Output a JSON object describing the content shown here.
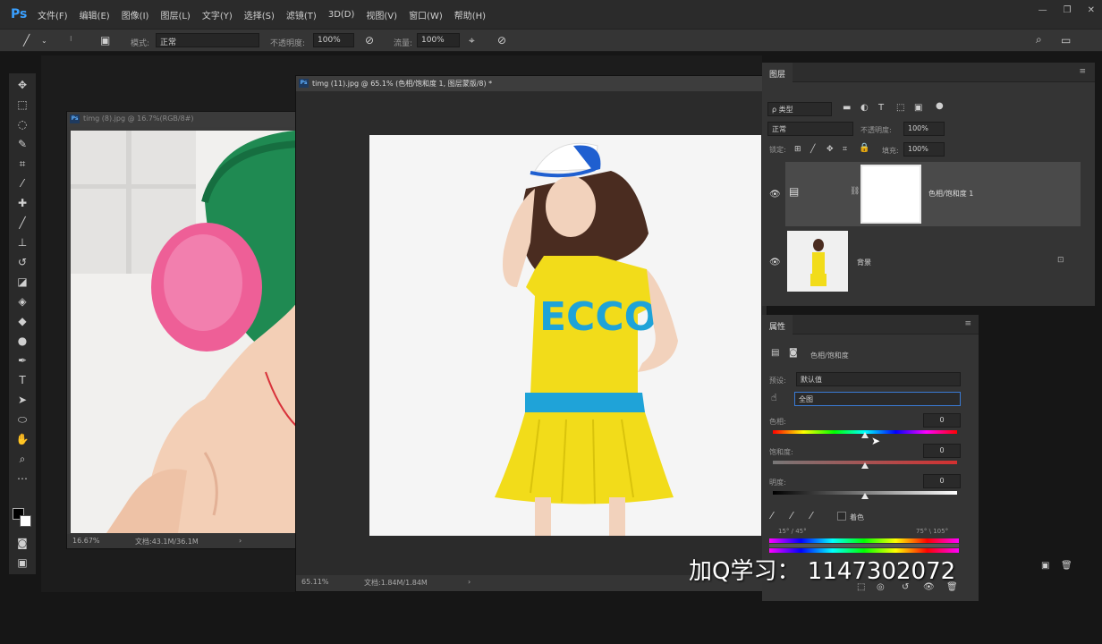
{
  "app": {
    "logo": "Ps"
  },
  "menu": [
    "文件(F)",
    "编辑(E)",
    "图像(I)",
    "图层(L)",
    "文字(Y)",
    "选择(S)",
    "滤镜(T)",
    "3D(D)",
    "视图(V)",
    "窗口(W)",
    "帮助(H)"
  ],
  "options": {
    "mode_label": "模式:",
    "mode_value": "正常",
    "opacity_label": "不透明度:",
    "opacity_value": "100%",
    "flow_label": "流量:",
    "flow_value": "100%"
  },
  "doc1": {
    "title": "timg (8).jpg @ 16.7%(RGB/8#)",
    "zoom": "16.67%",
    "docsize": "文档:43.1M/36.1M"
  },
  "doc2": {
    "title": "timg (11).jpg @ 65.1% (色相/饱和度 1, 图层蒙版/8) *",
    "zoom": "65.11%",
    "docsize": "文档:1.84M/1.84M",
    "logo_text": "ECCO"
  },
  "layers": {
    "tab": "图层",
    "filter_label": "ρ 类型",
    "blend_mode": "正常",
    "opacity_label": "不透明度:",
    "opacity_value": "100%",
    "lock_label": "锁定:",
    "fill_label": "填充:",
    "fill_value": "100%",
    "items": [
      {
        "name": "色相/饱和度 1"
      },
      {
        "name": "背景"
      }
    ]
  },
  "properties": {
    "tab": "属性",
    "title": "色相/饱和度",
    "preset_label": "预设:",
    "preset_value": "默认值",
    "channel_value": "全图",
    "hue_label": "色相:",
    "hue_value": "0",
    "sat_label": "饱和度:",
    "sat_value": "0",
    "light_label": "明度:",
    "light_value": "0",
    "colorize_label": "着色",
    "range_left": "15° / 45°",
    "range_right": "75° \\ 105°",
    "hue_pos": 0.5,
    "sat_pos": 0.5,
    "light_pos": 0.5
  },
  "watermark": "加Q学习：  1147302072",
  "colors": {
    "accent": "#3aa0ff",
    "panel": "#343434",
    "shirt": "#f2dc1a",
    "print": "#1fa3d8"
  }
}
